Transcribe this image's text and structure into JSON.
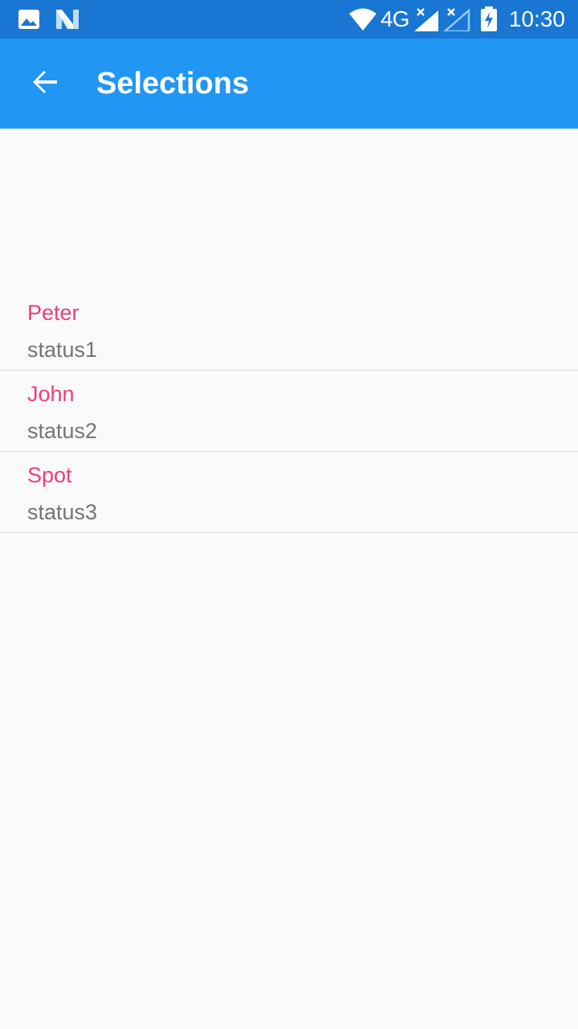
{
  "status_bar": {
    "time": "10:30",
    "network": "4G",
    "icons": [
      "image-icon",
      "notification-n-icon",
      "wifi-icon",
      "cell-signal-icon",
      "cell-signal-2-icon",
      "battery-charging-icon"
    ]
  },
  "app_bar": {
    "title": "Selections",
    "back_icon": "arrow-back-icon",
    "background": "#2196f3"
  },
  "list": {
    "items": [
      {
        "name": "Peter",
        "status": "status1"
      },
      {
        "name": "John",
        "status": "status2"
      },
      {
        "name": "Spot",
        "status": "status3"
      }
    ],
    "name_color": "#ec407a",
    "status_color": "#757575"
  }
}
